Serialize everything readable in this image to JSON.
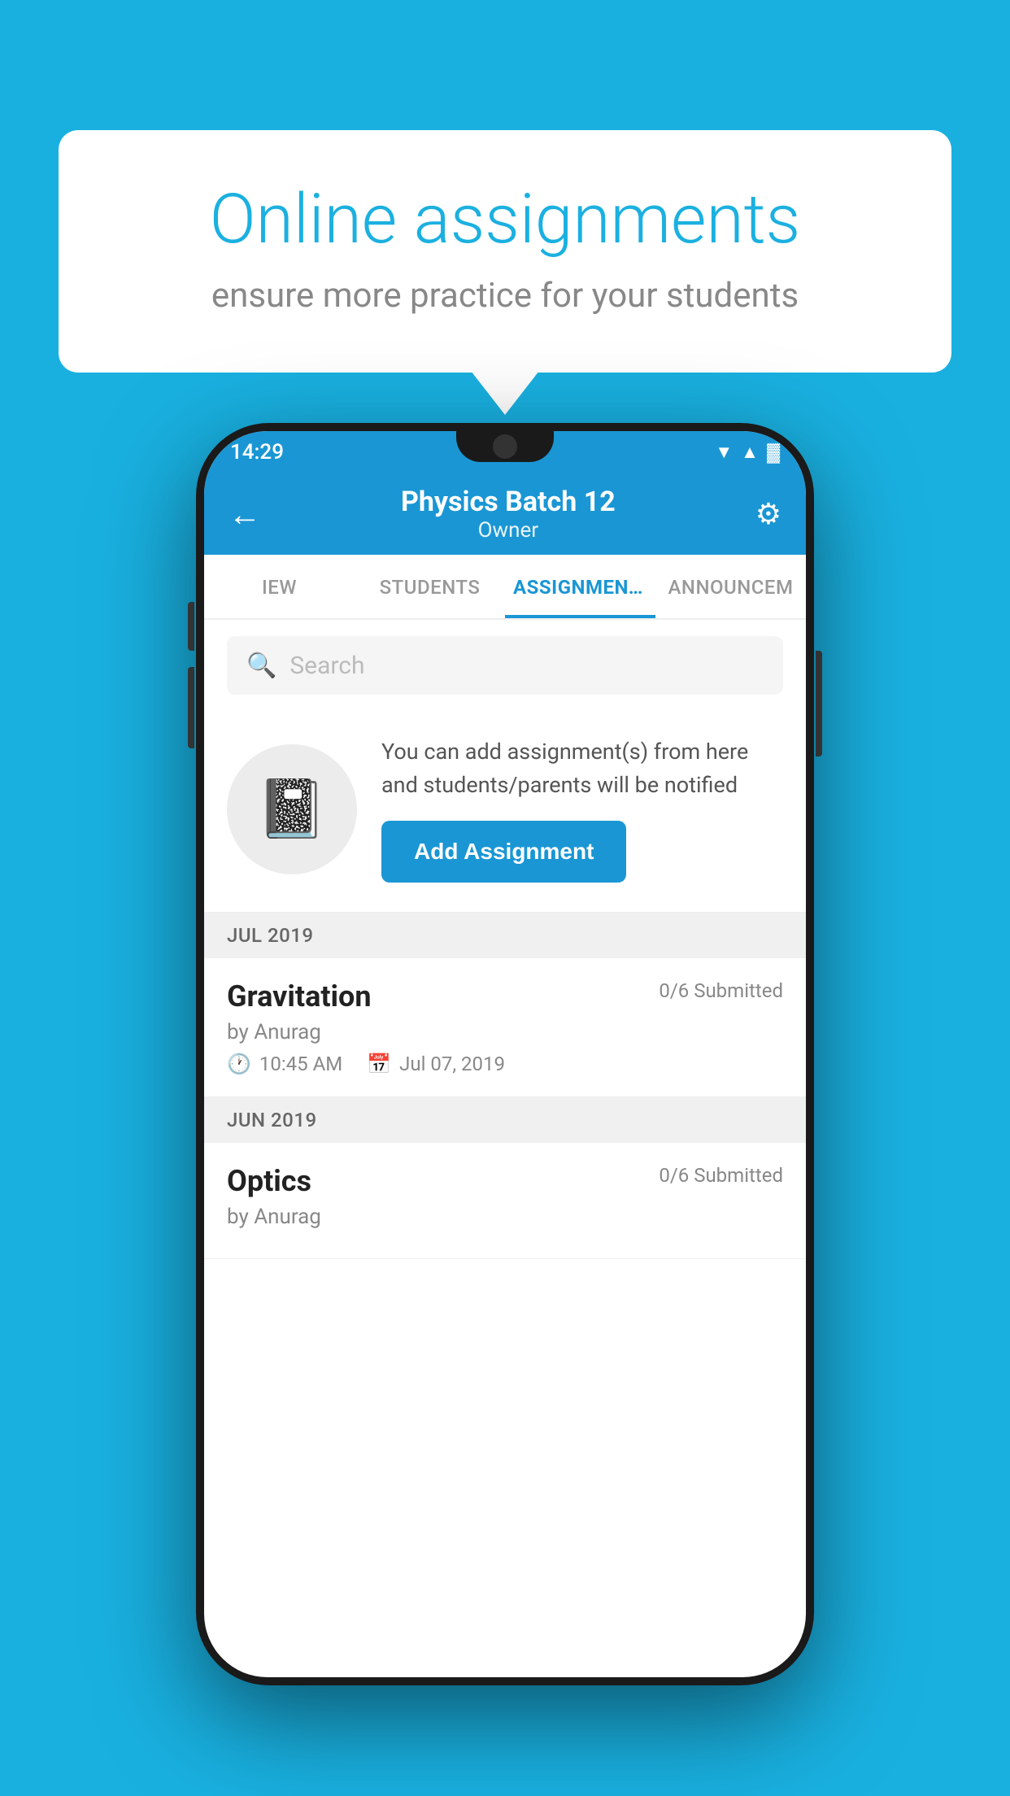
{
  "background": {
    "color": "#19b0e0"
  },
  "speech_bubble": {
    "title": "Online assignments",
    "subtitle": "ensure more practice for your students"
  },
  "status_bar": {
    "time": "14:29",
    "wifi": "▼▲",
    "battery": "▓"
  },
  "top_bar": {
    "title": "Physics Batch 12",
    "subtitle": "Owner",
    "back_label": "←",
    "settings_label": "⚙"
  },
  "tabs": [
    {
      "label": "IEW",
      "active": false
    },
    {
      "label": "STUDENTS",
      "active": false
    },
    {
      "label": "ASSIGNMENTS",
      "active": true
    },
    {
      "label": "ANNOUNCEM",
      "active": false
    }
  ],
  "search": {
    "placeholder": "Search"
  },
  "info_section": {
    "description": "You can add assignment(s) from here and students/parents will be notified",
    "add_button_label": "Add Assignment"
  },
  "assignments": {
    "months": [
      {
        "month_label": "JUL 2019",
        "items": [
          {
            "name": "Gravitation",
            "submitted": "0/6 Submitted",
            "author": "by Anurag",
            "time": "10:45 AM",
            "date": "Jul 07, 2019"
          }
        ]
      },
      {
        "month_label": "JUN 2019",
        "items": [
          {
            "name": "Optics",
            "submitted": "0/6 Submitted",
            "author": "by Anurag",
            "time": "",
            "date": ""
          }
        ]
      }
    ]
  }
}
